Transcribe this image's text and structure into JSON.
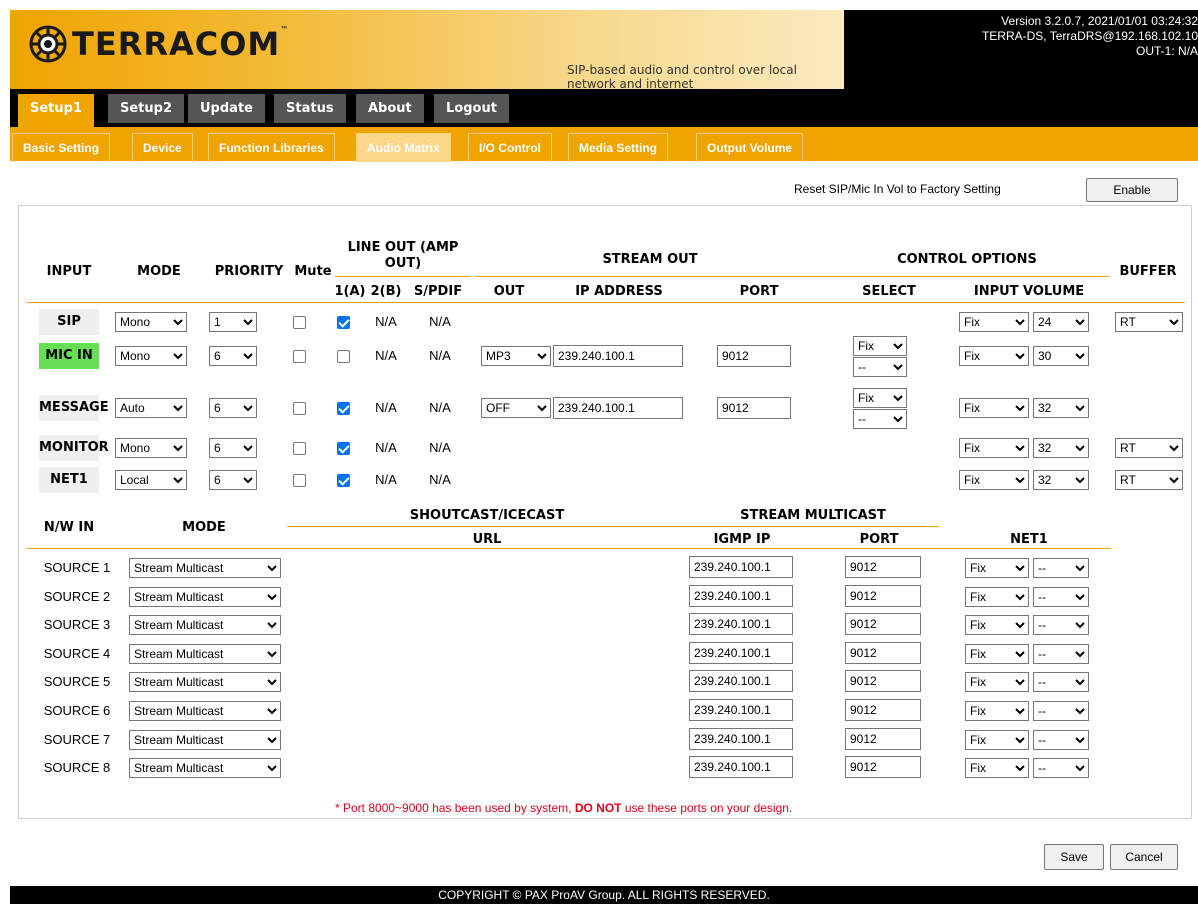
{
  "header": {
    "brand": "TERRACOM",
    "tm": "™",
    "tagline": "SIP-based audio and control over local network and internet",
    "version_line": "Version 3.2.0.7, 2021/01/01 03:24:32",
    "device_line": "TERRA-DS, TerraDRS@192.168.102.10",
    "output_line": "OUT-1: N/A"
  },
  "main_tabs": [
    "Setup1",
    "Setup2",
    "Update",
    "Status",
    "About",
    "Logout"
  ],
  "sub_tabs": [
    "Basic Setting",
    "Device",
    "Function Libraries",
    "Audio Matrix",
    "I/O Control",
    "Media Setting",
    "Output Volume"
  ],
  "reset": {
    "label": "Reset SIP/Mic In Vol to Factory Setting",
    "button": "Enable"
  },
  "matrix_headers": {
    "input": "INPUT",
    "mode": "MODE",
    "priority": "PRIORITY",
    "mute": "Mute",
    "line_out": "LINE OUT (AMP OUT)",
    "c1a": "1(A)",
    "c2b": "2(B)",
    "spdif": "S/PDIF",
    "stream_out": "STREAM OUT",
    "out": "OUT",
    "ip": "IP ADDRESS",
    "port": "PORT",
    "control": "CONTROL OPTIONS",
    "select": "SELECT",
    "input_volume": "INPUT VOLUME",
    "buffer": "BUFFER"
  },
  "inputs": [
    {
      "name": "SIP",
      "mode": "Mono",
      "priority": "1",
      "mute": false,
      "a": true,
      "b": "N/A",
      "spdif": "N/A",
      "out": "",
      "ip": "",
      "port": "",
      "select1": "",
      "select2": "",
      "vol_mode": "Fix",
      "vol": "24",
      "buffer": "RT"
    },
    {
      "name": "MIC IN",
      "mode": "Mono",
      "priority": "6",
      "mute": false,
      "a": false,
      "b": "N/A",
      "spdif": "N/A",
      "out": "MP3",
      "ip": "239.240.100.1",
      "port": "9012",
      "select1": "Fix",
      "select2": "--",
      "vol_mode": "Fix",
      "vol": "30",
      "buffer": ""
    },
    {
      "name": "MESSAGE",
      "mode": "Auto",
      "priority": "6",
      "mute": false,
      "a": true,
      "b": "N/A",
      "spdif": "N/A",
      "out": "OFF",
      "ip": "239.240.100.1",
      "port": "9012",
      "select1": "Fix",
      "select2": "--",
      "vol_mode": "Fix",
      "vol": "32",
      "buffer": ""
    },
    {
      "name": "MONITOR",
      "mode": "Mono",
      "priority": "6",
      "mute": false,
      "a": true,
      "b": "N/A",
      "spdif": "N/A",
      "out": "",
      "ip": "",
      "port": "",
      "select1": "",
      "select2": "",
      "vol_mode": "Fix",
      "vol": "32",
      "buffer": "RT"
    },
    {
      "name": "NET1",
      "mode": "Local",
      "priority": "6",
      "mute": false,
      "a": true,
      "b": "N/A",
      "spdif": "N/A",
      "out": "",
      "ip": "",
      "port": "",
      "select1": "",
      "select2": "",
      "vol_mode": "Fix",
      "vol": "32",
      "buffer": "RT"
    }
  ],
  "nw_headers": {
    "nw_in": "N/W IN",
    "mode": "MODE",
    "shoutcast": "SHOUTCAST/ICECAST",
    "url": "URL",
    "multicast": "STREAM MULTICAST",
    "igmp": "IGMP IP",
    "port": "PORT",
    "net1": "NET1"
  },
  "sources": [
    {
      "name": "SOURCE 1",
      "mode": "Stream Multicast",
      "igmp": "239.240.100.1",
      "port": "9012",
      "net1a": "Fix",
      "net1b": "--"
    },
    {
      "name": "SOURCE 2",
      "mode": "Stream Multicast",
      "igmp": "239.240.100.1",
      "port": "9012",
      "net1a": "Fix",
      "net1b": "--"
    },
    {
      "name": "SOURCE 3",
      "mode": "Stream Multicast",
      "igmp": "239.240.100.1",
      "port": "9012",
      "net1a": "Fix",
      "net1b": "--"
    },
    {
      "name": "SOURCE 4",
      "mode": "Stream Multicast",
      "igmp": "239.240.100.1",
      "port": "9012",
      "net1a": "Fix",
      "net1b": "--"
    },
    {
      "name": "SOURCE 5",
      "mode": "Stream Multicast",
      "igmp": "239.240.100.1",
      "port": "9012",
      "net1a": "Fix",
      "net1b": "--"
    },
    {
      "name": "SOURCE 6",
      "mode": "Stream Multicast",
      "igmp": "239.240.100.1",
      "port": "9012",
      "net1a": "Fix",
      "net1b": "--"
    },
    {
      "name": "SOURCE 7",
      "mode": "Stream Multicast",
      "igmp": "239.240.100.1",
      "port": "9012",
      "net1a": "Fix",
      "net1b": "--"
    },
    {
      "name": "SOURCE 8",
      "mode": "Stream Multicast",
      "igmp": "239.240.100.1",
      "port": "9012",
      "net1a": "Fix",
      "net1b": "--"
    }
  ],
  "note": {
    "pre": "* Port 8000~9000 has been used by system, ",
    "strong": "DO NOT",
    "post": " use these ports on your design."
  },
  "buttons": {
    "save": "Save",
    "cancel": "Cancel"
  },
  "footer": "COPYRIGHT © PAX ProAV Group. ALL RIGHTS RESERVED."
}
